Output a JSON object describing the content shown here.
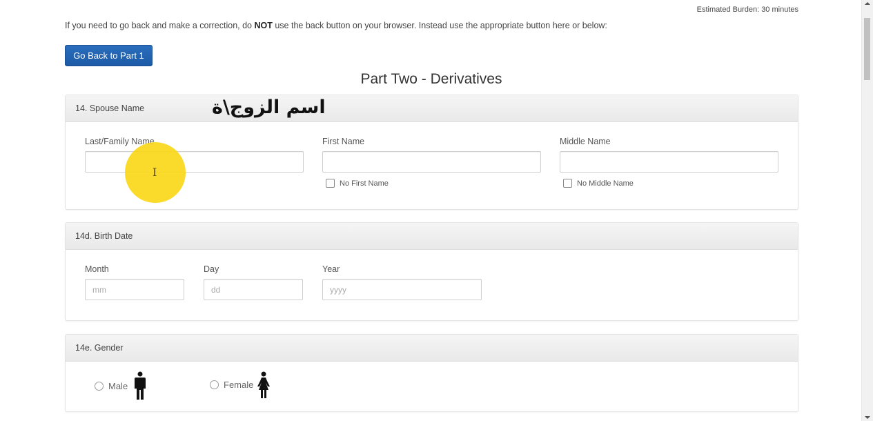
{
  "header": {
    "burden": "Estimated Burden: 30 minutes",
    "notice_before": "If you need to go back and make a correction, do ",
    "notice_bold": "NOT",
    "notice_after": " use the back button on your browser. Instead use the appropriate button here or below:",
    "back_button": "Go Back to Part 1",
    "part_title": "Part Two - Derivatives"
  },
  "spouse_name": {
    "heading": "14. Spouse Name",
    "annotation": "اسم الزوج\\ة",
    "last_label": "Last/Family Name",
    "last_value": "",
    "first_label": "First Name",
    "first_value": "",
    "no_first_label": "No First Name",
    "middle_label": "Middle Name",
    "middle_value": "",
    "no_middle_label": "No Middle Name"
  },
  "birth_date": {
    "heading": "14d. Birth Date",
    "month_label": "Month",
    "month_placeholder": "mm",
    "day_label": "Day",
    "day_placeholder": "dd",
    "year_label": "Year",
    "year_placeholder": "yyyy"
  },
  "gender": {
    "heading": "14e. Gender",
    "male_label": "Male",
    "female_label": "Female",
    "male_icon": "male-person-icon",
    "female_icon": "female-person-icon"
  },
  "cursor": {
    "icon": "text-cursor-icon",
    "highlight_color": "#f9d414"
  }
}
